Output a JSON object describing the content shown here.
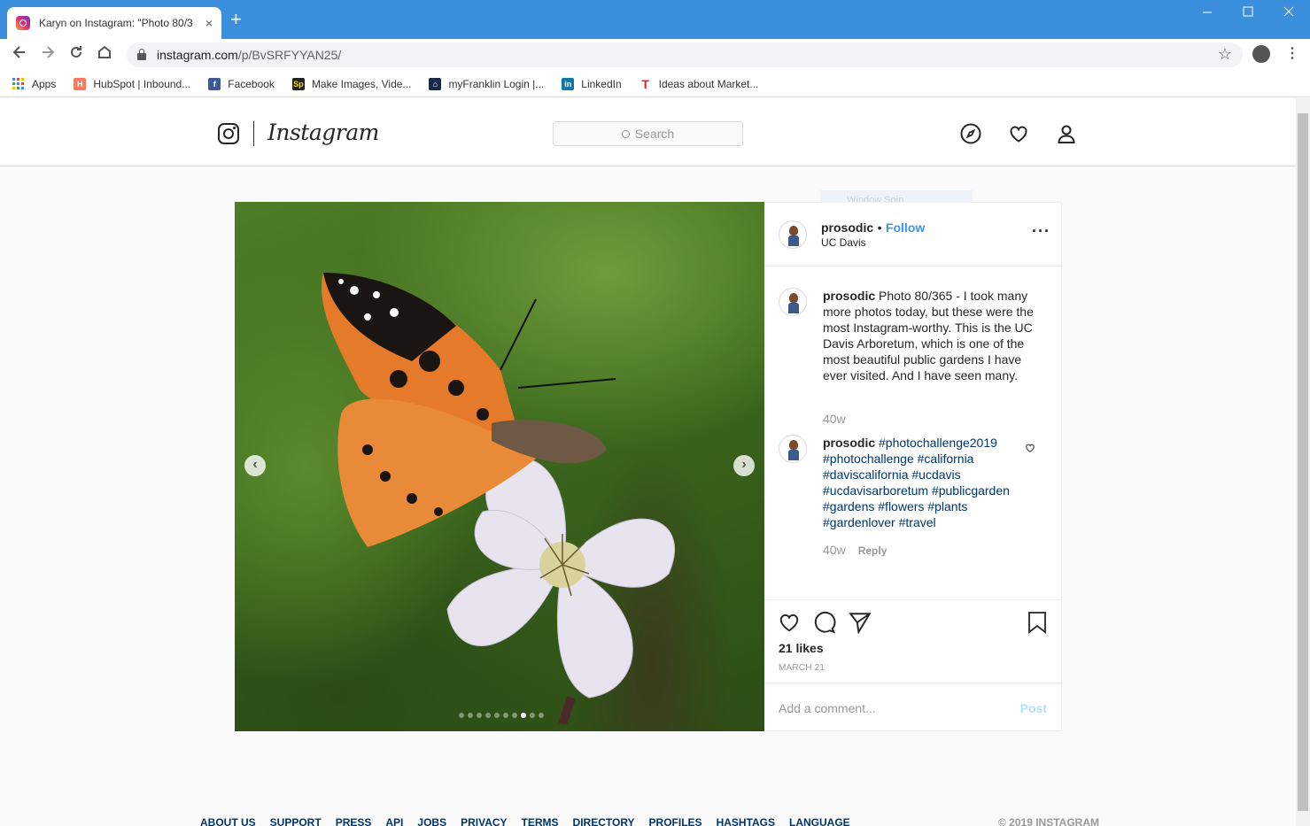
{
  "browser": {
    "tab_title": "Karyn on Instagram: \"Photo 80/3",
    "tab_close": "×",
    "new_tab": "+",
    "url_host": "instagram.com",
    "url_path": "/p/BvSRFYYAN25/",
    "bookmarks": [
      {
        "label": "Apps",
        "icon": "apps-grid-icon",
        "color": "#4285f4"
      },
      {
        "label": "HubSpot | Inbound...",
        "icon": "hubspot-icon",
        "color": "#ff7a59"
      },
      {
        "label": "Facebook",
        "icon": "facebook-icon",
        "color": "#3b5998"
      },
      {
        "label": "Make Images, Vide...",
        "icon": "spark-icon",
        "color": "#222222"
      },
      {
        "label": "myFranklin Login |...",
        "icon": "franklin-icon",
        "color": "#1a2a4a"
      },
      {
        "label": "LinkedIn",
        "icon": "linkedin-icon",
        "color": "#0e76a8"
      },
      {
        "label": "Ideas about Market...",
        "icon": "t-icon",
        "color": "#e02020"
      }
    ]
  },
  "header": {
    "wordmark": "Instagram",
    "search_placeholder": "Search"
  },
  "post": {
    "username": "prosodic",
    "follow": "Follow",
    "bullet": "•",
    "location": "UC Davis",
    "caption_user": "prosodic",
    "caption": " Photo 80/365 - I took many more photos today, but these were the most Instagram-worthy. This is the UC Davis Arboretum, which is one of the most beautiful public gardens I have ever visited. And I have seen many.",
    "caption_age": "40w",
    "comment_user": "prosodic",
    "comment_tags": "#photochallenge2019 #photochallenge #california #daviscalifornia #ucdavis #ucdavisarboretum #publicgarden #gardens #flowers #plants #gardenlover #travel",
    "comment_age": "40w",
    "reply": "Reply",
    "likes": "21 likes",
    "date": "MARCH 21",
    "add_comment_placeholder": "Add a comment...",
    "post_button": "Post",
    "carousel_total": 10,
    "carousel_active": 8,
    "snip_text": "Window Snip"
  },
  "footer": {
    "links": [
      "ABOUT US",
      "SUPPORT",
      "PRESS",
      "API",
      "JOBS",
      "PRIVACY",
      "TERMS",
      "DIRECTORY",
      "PROFILES",
      "HASHTAGS",
      "LANGUAGE"
    ],
    "copyright": "© 2019 INSTAGRAM"
  }
}
